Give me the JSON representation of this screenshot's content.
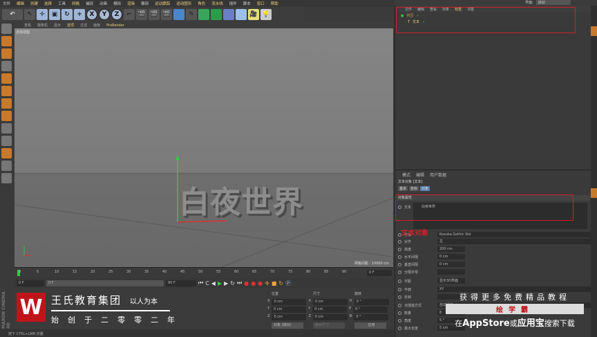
{
  "menu": [
    "文件",
    "编辑",
    "创建",
    "选择",
    "工具",
    "网格",
    "捕捉",
    "动画",
    "模拟",
    "渲染",
    "雕刻",
    "运动跟踪",
    "运动图形",
    "角色",
    "流水线",
    "插件",
    "脚本",
    "窗口",
    "帮助"
  ],
  "viewport_menu": [
    "查看",
    "摄像机",
    "显示",
    "选项",
    "过滤",
    "面板",
    "ProRender"
  ],
  "viewport_label": "透视视图",
  "grid_info": "网格间距 : 10000 cm",
  "text_object": "白夜世界",
  "timeline_ticks": [
    "0",
    "5",
    "10",
    "15",
    "20",
    "25",
    "30",
    "35",
    "40",
    "45",
    "50",
    "55",
    "60",
    "65",
    "70",
    "75",
    "80",
    "85",
    "90"
  ],
  "frame_end_label": "0 F",
  "controls": {
    "current": "0 F",
    "range_start": "0 F",
    "range_end": "90 F",
    "max": "90 F"
  },
  "coords": {
    "headers": [
      "位置",
      "尺寸",
      "旋转"
    ],
    "rows": [
      [
        "X",
        "0 cm",
        "X",
        "0 cm",
        "H",
        "0 °"
      ],
      [
        "Y",
        "0 cm",
        "Y",
        "0 cm",
        "P",
        "0 °"
      ],
      [
        "Z",
        "0 cm",
        "Z",
        "0 cm",
        "B",
        "0 °"
      ]
    ],
    "mode": "对象 (相对)",
    "size_mode": "绝对尺寸",
    "apply": "应用"
  },
  "status": "按下 CTRL+LMB 折叠",
  "maxon": "MAXON CINEMA 4D",
  "brand": {
    "logo": "W",
    "name": "王氏教育集团",
    "motto": "以人为本",
    "since": "始创于二零零二年"
  },
  "interface": {
    "label": "界面:",
    "value": "启动"
  },
  "object_manager": {
    "menu": [
      "文件",
      "编辑",
      "查看",
      "对象",
      "标签",
      "书签"
    ],
    "objects": [
      {
        "name": "挤压"
      },
      {
        "name": "文本"
      }
    ]
  },
  "attributes": {
    "menu": [
      "模式",
      "编辑",
      "用户数据"
    ],
    "title": "文本对象 [文本]",
    "tabs": [
      "基本",
      "坐标",
      "对象"
    ],
    "section": "对象属性",
    "fields": [
      {
        "label": "文本",
        "value": "白夜世界"
      },
      {
        "label": "字体",
        "value": "Kozuka Gothic Std"
      },
      {
        "label": "对齐",
        "value": "左"
      },
      {
        "label": "高度",
        "value": "200 cm"
      },
      {
        "label": "水平间隔",
        "value": "0 cm"
      },
      {
        "label": "垂直间隔",
        "value": "0 cm"
      },
      {
        "label": "分隔字母",
        "value": ""
      },
      {
        "label": "字距",
        "value": "显示3D界面"
      },
      {
        "label": "平面",
        "value": "XY"
      },
      {
        "label": "反转",
        "value": ""
      },
      {
        "label": "点插值方式",
        "value": "自动适应"
      },
      {
        "label": "数量",
        "value": "8"
      },
      {
        "label": "角度",
        "value": "5 °"
      },
      {
        "label": "最大长度",
        "value": "5 cm"
      }
    ]
  },
  "annotation": "文本对象",
  "promo": {
    "line1": "获得更多免费精品教程",
    "line2": "绘学霸",
    "line3_pre": "在",
    "line3_app": "AppStore",
    "line3_mid": "或",
    "line3_yyb": "应用宝",
    "line3_post": "搜索下载"
  }
}
